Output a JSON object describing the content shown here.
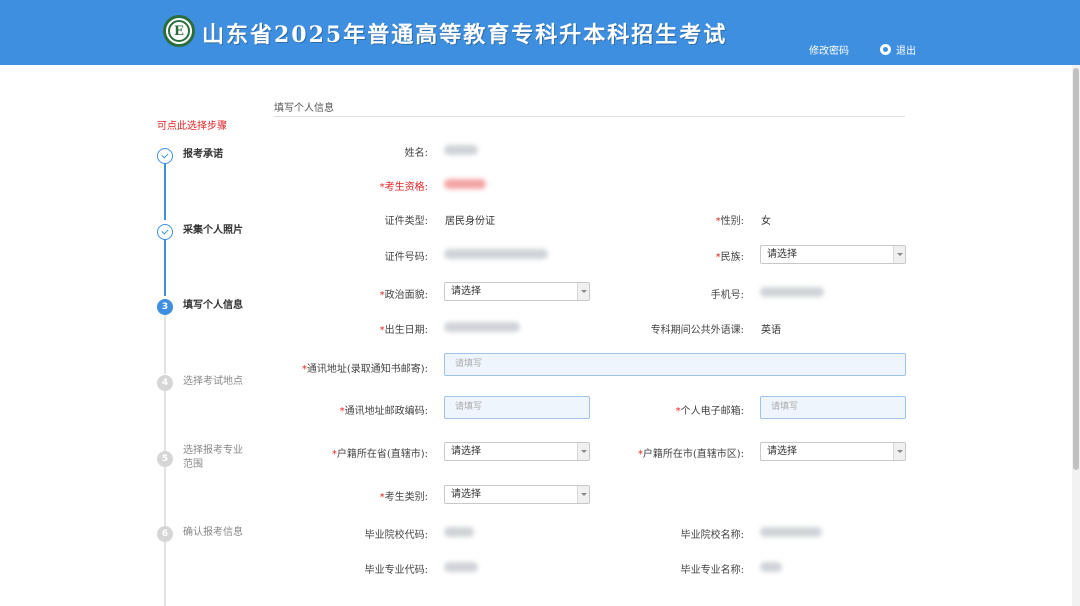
{
  "header": {
    "title": "山东省2025年普通高等教育专科升本科招生考试",
    "logo_letter": "E",
    "change_password": "修改密码",
    "logout": "退出"
  },
  "sidebar": {
    "hint": "可点此选择步骤",
    "steps": [
      {
        "num": "",
        "label": "报考承诺",
        "state": "done"
      },
      {
        "num": "",
        "label": "采集个人照片",
        "state": "done"
      },
      {
        "num": "3",
        "label": "填写个人信息",
        "state": "active"
      },
      {
        "num": "4",
        "label": "选择考试地点",
        "state": "todo"
      },
      {
        "num": "5",
        "label": "选择报考专业范围",
        "state": "todo"
      },
      {
        "num": "6",
        "label": "确认报考信息",
        "state": "todo"
      }
    ]
  },
  "form": {
    "section_title": "填写个人信息",
    "name_label": "姓名:",
    "qualification_label": "考生资格:",
    "id_type_label": "证件类型:",
    "id_type_value": "居民身份证",
    "gender_label": "性别:",
    "gender_value": "女",
    "id_number_label": "证件号码:",
    "ethnicity_label": "民族:",
    "ethnicity_value": "请选择",
    "politics_label": "政治面貌:",
    "politics_value": "请选择",
    "phone_label": "手机号:",
    "birth_label": "出生日期:",
    "foreign_lang_label": "专科期间公共外语课:",
    "foreign_lang_value": "英语",
    "address_label": "通讯地址(录取通知书邮寄):",
    "address_placeholder": "请填写",
    "postcode_label": "通讯地址邮政编码:",
    "postcode_placeholder": "请填写",
    "email_label": "个人电子邮箱:",
    "email_placeholder": "请填写",
    "province_label": "户籍所在省(直辖市):",
    "province_value": "请选择",
    "city_label": "户籍所在市(直辖市区):",
    "city_value": "请选择",
    "category_label": "考生类别:",
    "category_value": "请选择",
    "school_code_label": "毕业院校代码:",
    "school_name_label": "毕业院校名称:",
    "major_code_label": "毕业专业代码:",
    "major_name_label": "毕业专业名称:"
  },
  "colors": {
    "header_bg": "#3f8fe0",
    "accent": "#3f8fe0",
    "required": "#e02424"
  }
}
